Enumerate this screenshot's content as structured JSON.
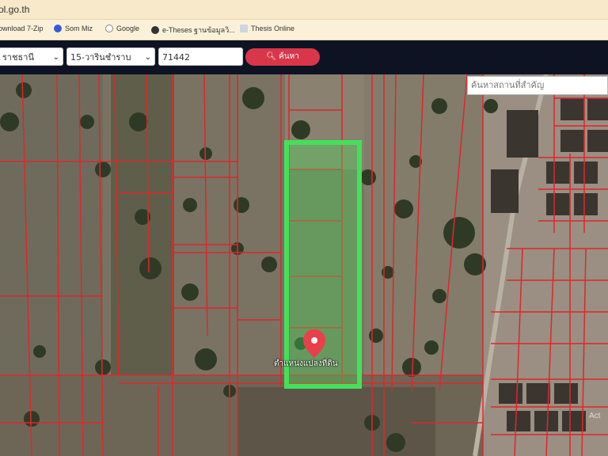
{
  "browser": {
    "url_fragment": "ol.go.th"
  },
  "bookmarks": [
    {
      "label": "ownload 7-Zip",
      "icon": "download-icon"
    },
    {
      "label": "Som Miz",
      "icon": "facebook-icon"
    },
    {
      "label": "Google",
      "icon": "google-icon"
    },
    {
      "label": "e-Theses ฐานข้อมูลวิ...",
      "icon": "globe-icon"
    },
    {
      "label": "Thesis Online",
      "icon": "document-icon"
    }
  ],
  "toolbar": {
    "province_value": "ราชธานี",
    "district_value": "15-วารินชำราบ",
    "parcel_number": "71442",
    "search_label": "ค้นหา"
  },
  "map": {
    "place_search_placeholder": "ค้นหาสถานที่สำคัญ",
    "pin_label": "ตำแหน่งแปลงที่ดิน",
    "watermark": "Act",
    "colors": {
      "parcel_line": "#e0262b",
      "highlight": "#44e05a",
      "pin": "#e8404b"
    }
  }
}
